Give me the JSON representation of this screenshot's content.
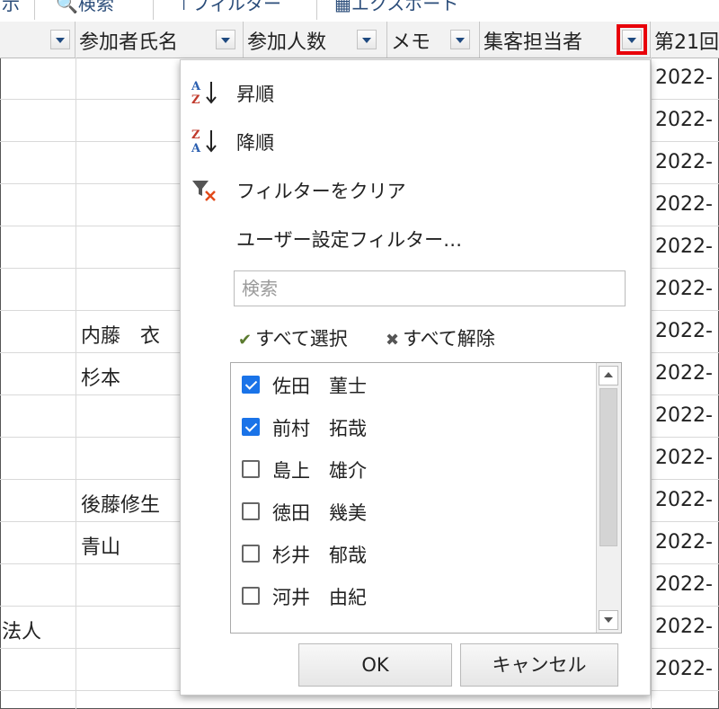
{
  "toolbar": {
    "items": [
      "示",
      "検索",
      "フィルター",
      "エクスポート"
    ]
  },
  "columns": [
    {
      "label": ""
    },
    {
      "label": "参加者氏名"
    },
    {
      "label": "参加人数"
    },
    {
      "label": "メモ"
    },
    {
      "label": "集客担当者"
    },
    {
      "label": "第21回"
    }
  ],
  "rows": [
    {
      "name": "",
      "date": "2022-"
    },
    {
      "name": "",
      "date": "2022-"
    },
    {
      "name": "",
      "date": "2022-"
    },
    {
      "name": "",
      "date": "2022-"
    },
    {
      "name": "",
      "date": "2022-"
    },
    {
      "name": "",
      "date": "2022-"
    },
    {
      "name": "内藤　衣",
      "date": "2022-"
    },
    {
      "name": "杉本",
      "date": "2022-"
    },
    {
      "name": "",
      "date": "2022-"
    },
    {
      "name": "",
      "date": "2022-"
    },
    {
      "name": "後藤修生",
      "date": "2022-"
    },
    {
      "name": "青山",
      "date": "2022-"
    },
    {
      "name": "",
      "date": "2022-"
    },
    {
      "name": "",
      "date": "2022-"
    },
    {
      "name": "",
      "date": "2022-"
    }
  ],
  "left_cell": "法人",
  "filter_menu": {
    "sort_asc": "昇順",
    "sort_desc": "降順",
    "clear_filter": "フィルターをクリア",
    "custom_filter": "ユーザー設定フィルター…",
    "search_placeholder": "検索",
    "select_all": "すべて選択",
    "deselect_all": "すべて解除",
    "items": [
      {
        "label": "佐田　菫士",
        "checked": true
      },
      {
        "label": "前村　拓哉",
        "checked": true
      },
      {
        "label": "島上　雄介",
        "checked": false
      },
      {
        "label": "徳田　幾美",
        "checked": false
      },
      {
        "label": "杉井　郁哉",
        "checked": false
      },
      {
        "label": "河井　由紀",
        "checked": false
      }
    ],
    "ok_label": "OK",
    "cancel_label": "キャンセル"
  },
  "colors": {
    "highlight": "#e8000a",
    "checkbox": "#1a73e8",
    "dropdown_arrow": "#1f4a80"
  }
}
